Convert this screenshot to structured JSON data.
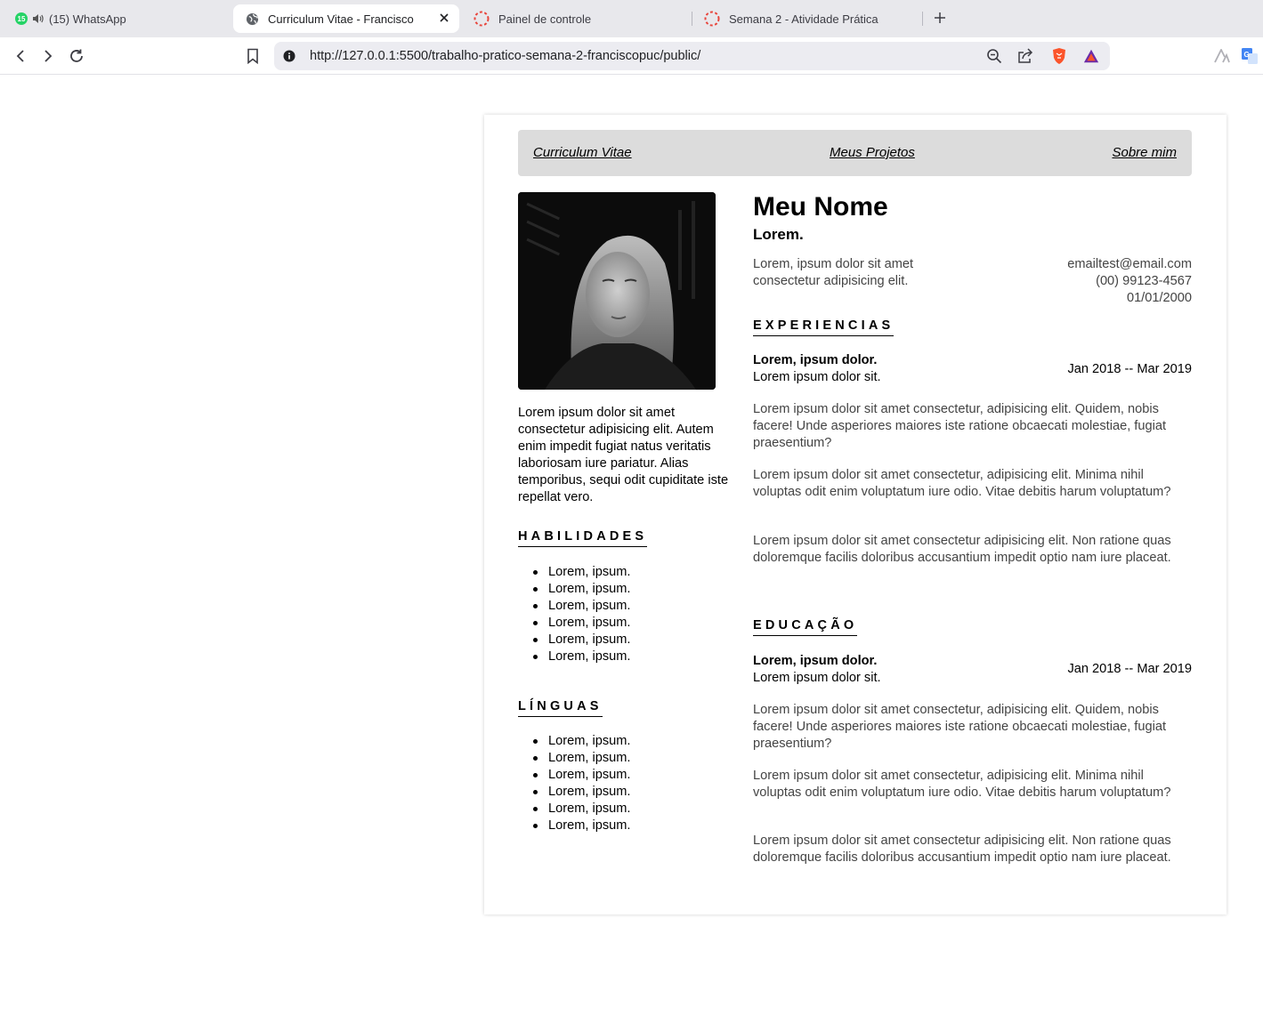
{
  "browser": {
    "tabs": [
      {
        "title": "(15) WhatsApp",
        "badge": "15"
      },
      {
        "title": "Curriculum Vitae - Francisco"
      },
      {
        "title": "Painel de controle"
      },
      {
        "title": "Semana 2 - Atividade Prática"
      }
    ],
    "url": "http://127.0.0.1:5500/trabalho-pratico-semana-2-franciscopuc/public/",
    "icons": [
      "back-icon",
      "forward-icon",
      "reload-icon",
      "bookmark-icon",
      "info-icon",
      "zoom-out-icon",
      "share-icon",
      "brave-shield-icon",
      "brave-rewards-icon",
      "aria-icon",
      "translate-icon"
    ],
    "colors": {
      "whatsapp": "#25d366",
      "brave": "#fb542b",
      "spinner": "#e8453c"
    }
  },
  "cv": {
    "nav": [
      "Curriculum Vitae",
      "Meus Projetos",
      "Sobre mim"
    ],
    "intro": "Lorem ipsum dolor sit amet consectetur adipisicing elit. Autem enim impedit fugiat natus veritatis laboriosam iure pariatur. Alias temporibus, sequi odit cupiditate iste repellat vero.",
    "skills": {
      "title": "HABILIDADES",
      "items": [
        "Lorem, ipsum.",
        "Lorem, ipsum.",
        "Lorem, ipsum.",
        "Lorem, ipsum.",
        "Lorem, ipsum.",
        "Lorem, ipsum."
      ]
    },
    "languages": {
      "title": "LÍNGUAS",
      "items": [
        "Lorem, ipsum.",
        "Lorem, ipsum.",
        "Lorem, ipsum.",
        "Lorem, ipsum.",
        "Lorem, ipsum.",
        "Lorem, ipsum."
      ]
    },
    "name": "Meu Nome",
    "subtitle": "Lorem.",
    "summary": "Lorem, ipsum dolor sit amet consectetur adipisicing elit.",
    "contact": {
      "email": "emailtest@email.com",
      "phone": "(00) 99123-4567",
      "birth": "01/01/2000"
    },
    "experience": {
      "title": "EXPERIENCIAS",
      "role": "Lorem, ipsum dolor.",
      "place": "Lorem ipsum dolor sit.",
      "date": "Jan 2018 -- Mar 2019",
      "paragraphs": [
        "Lorem ipsum dolor sit amet consectetur, adipisicing elit. Quidem, nobis facere! Unde asperiores maiores iste ratione obcaecati molestiae, fugiat praesentium?",
        "Lorem ipsum dolor sit amet consectetur, adipisicing elit. Minima nihil voluptas odit enim voluptatum iure odio. Vitae debitis harum voluptatum?",
        "Lorem ipsum dolor sit amet consectetur adipisicing elit. Non ratione quas doloremque facilis doloribus accusantium impedit optio nam iure placeat."
      ]
    },
    "education": {
      "title": "EDUCAÇÃO",
      "role": "Lorem, ipsum dolor.",
      "place": "Lorem ipsum dolor sit.",
      "date": "Jan 2018 -- Mar 2019",
      "paragraphs": [
        "Lorem ipsum dolor sit amet consectetur, adipisicing elit. Quidem, nobis facere! Unde asperiores maiores iste ratione obcaecati molestiae, fugiat praesentium?",
        "Lorem ipsum dolor sit amet consectetur, adipisicing elit. Minima nihil voluptas odit enim voluptatum iure odio. Vitae debitis harum voluptatum?",
        "Lorem ipsum dolor sit amet consectetur adipisicing elit. Non ratione quas doloremque facilis doloribus accusantium impedit optio nam iure placeat."
      ]
    }
  }
}
